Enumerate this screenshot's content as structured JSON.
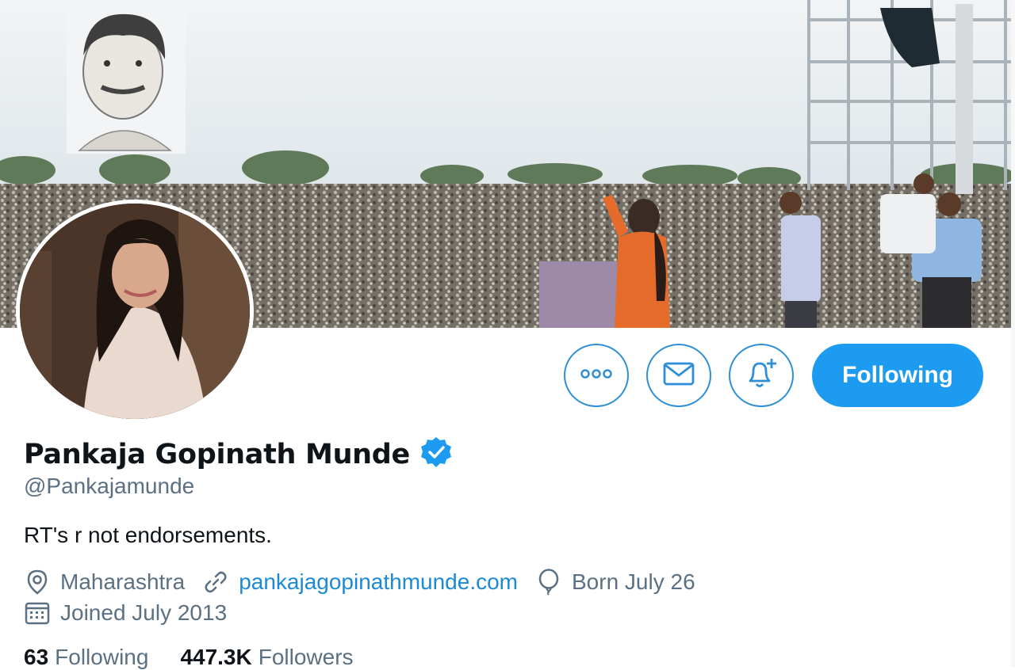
{
  "profile": {
    "name": "Pankaja Gopinath Munde",
    "handle": "@Pankajamunde",
    "bio": "RT's r not endorsements.",
    "location": "Maharashtra",
    "website": "pankajagopinathmunde.com",
    "birthday": "Born July 26",
    "joined": "Joined July 2013",
    "verified": true
  },
  "actions": {
    "follow_label": "Following"
  },
  "stats": {
    "following_count": "63",
    "following_label": "Following",
    "followers_count": "447.3K",
    "followers_label": "Followers"
  },
  "colors": {
    "accent": "#1d9bf0",
    "link": "#1b8ad6",
    "secondary_text": "#5b7083"
  },
  "icons": [
    "more-icon",
    "mail-icon",
    "bell-plus-icon",
    "verified-badge-icon",
    "location-icon",
    "link-icon",
    "balloon-icon",
    "calendar-icon"
  ]
}
